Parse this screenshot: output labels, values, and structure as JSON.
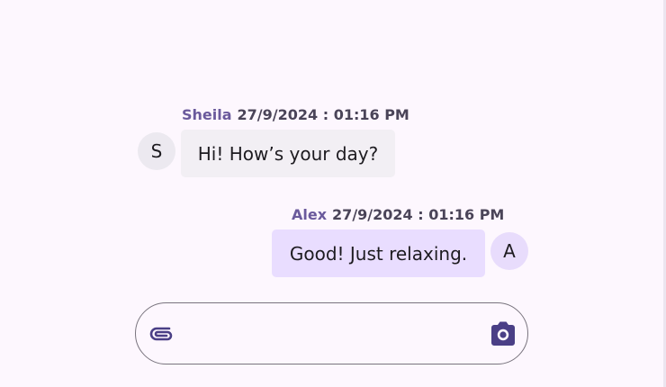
{
  "messages": [
    {
      "author": "Sheila",
      "timestamp": "27/9/2024 : 01:16 PM",
      "text": "Hi! How’s your day?",
      "avatar_initial": "S",
      "direction": "incoming"
    },
    {
      "author": "Alex",
      "timestamp": "27/9/2024 : 01:16 PM",
      "text": "Good! Just relaxing.",
      "avatar_initial": "A",
      "direction": "outgoing"
    }
  ],
  "composer": {
    "value": "",
    "placeholder": "",
    "attach_icon": "paperclip-icon",
    "camera_icon": "camera-icon"
  },
  "colors": {
    "background": "#fdf7fe",
    "author_name": "#6a5a9c",
    "incoming_bubble": "#f2eff4",
    "outgoing_bubble": "#e9ddff",
    "icon": "#4a3f86"
  }
}
